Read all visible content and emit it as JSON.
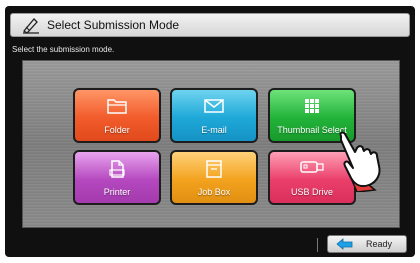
{
  "header": {
    "title": "Select Submission Mode",
    "icon": "edit-pen-icon"
  },
  "instruction": "Select the submission mode.",
  "tiles": [
    {
      "label": "Folder",
      "icon": "folder-icon",
      "color": "#f25b2b"
    },
    {
      "label": "E-mail",
      "icon": "envelope-icon",
      "color": "#1ea8d8"
    },
    {
      "label": "Thumbnail Select",
      "icon": "grid-icon",
      "color": "#22b33a"
    },
    {
      "label": "Printer",
      "icon": "document-icon",
      "color": "#b548bf"
    },
    {
      "label": "Job Box",
      "icon": "box-icon",
      "color": "#f3a21e"
    },
    {
      "label": "USB Drive",
      "icon": "usb-drive-icon",
      "color": "#ea3f6a"
    }
  ],
  "footer": {
    "ready_label": "Ready",
    "ready_icon": "return-arrow-icon",
    "ready_icon_color": "#1ea0e6"
  }
}
